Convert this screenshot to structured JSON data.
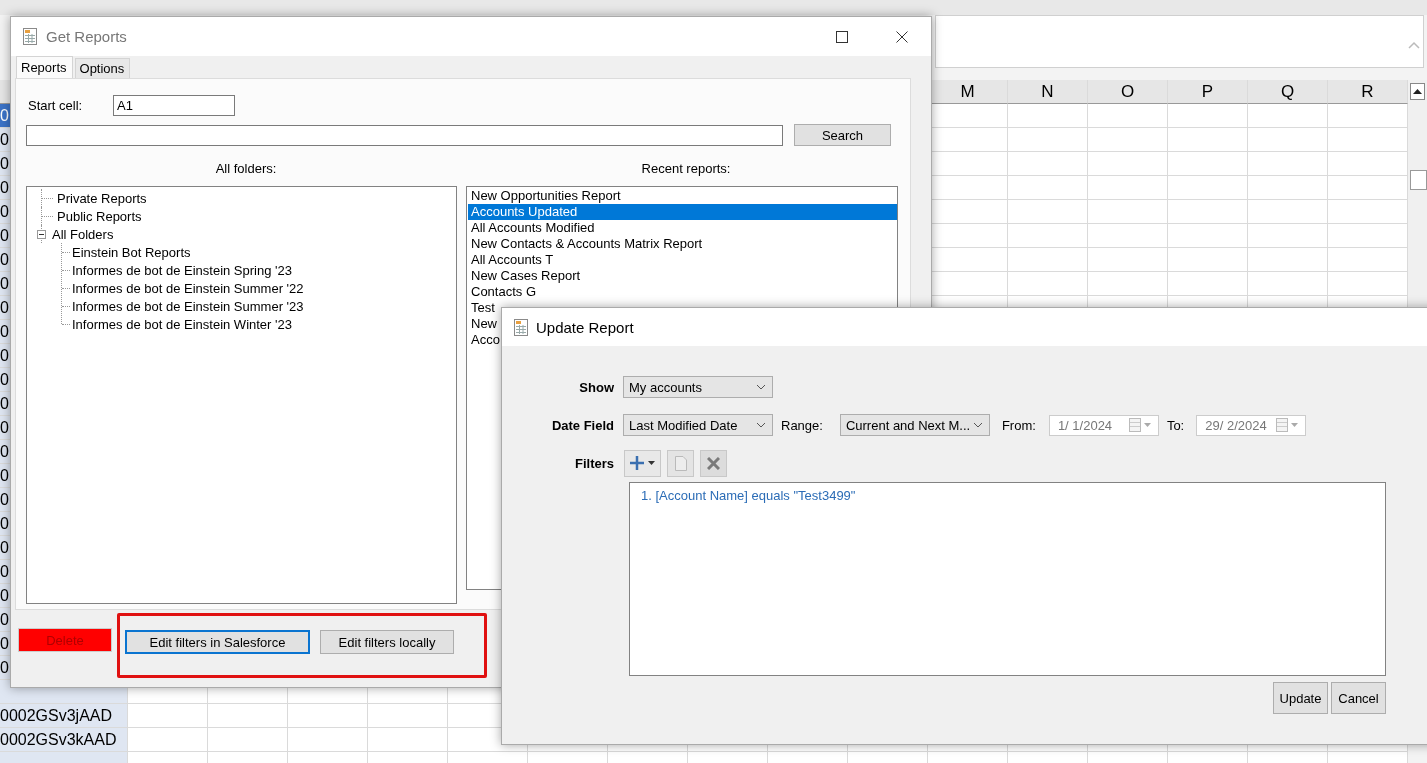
{
  "sheet": {
    "columns": [
      {
        "label": "M"
      },
      {
        "label": "N"
      },
      {
        "label": "O"
      },
      {
        "label": "P"
      },
      {
        "label": "Q"
      },
      {
        "label": "R"
      }
    ],
    "rows": [
      {
        "cell": "0",
        "selected": true
      },
      {
        "cell": "0",
        "selected": false
      },
      {
        "cell": "0",
        "selected": false
      },
      {
        "cell": "0",
        "selected": false
      },
      {
        "cell": "0",
        "selected": false
      },
      {
        "cell": "0",
        "selected": false
      },
      {
        "cell": "0",
        "selected": false
      },
      {
        "cell": "0",
        "selected": false
      },
      {
        "cell": "0",
        "selected": false
      },
      {
        "cell": "0",
        "selected": false
      },
      {
        "cell": "0",
        "selected": false
      },
      {
        "cell": "0",
        "selected": false
      },
      {
        "cell": "0",
        "selected": false
      },
      {
        "cell": "0",
        "selected": false
      },
      {
        "cell": "0",
        "selected": false
      },
      {
        "cell": "0",
        "selected": false
      },
      {
        "cell": "0",
        "selected": false
      },
      {
        "cell": "0",
        "selected": false
      },
      {
        "cell": "0",
        "selected": false
      },
      {
        "cell": "0",
        "selected": false
      },
      {
        "cell": "0",
        "selected": false
      },
      {
        "cell": "0",
        "selected": false
      },
      {
        "cell": "0",
        "selected": false
      },
      {
        "cell": "0",
        "selected": false
      },
      {
        "selected": false
      },
      {
        "cell": "0002GSv3jAAD",
        "selected": false
      },
      {
        "cell": "0002GSv3kAAD",
        "selected": false
      },
      {
        "selected": false
      }
    ]
  },
  "get_reports": {
    "title": "Get Reports",
    "tabs": [
      {
        "label": "Reports",
        "selected": true
      },
      {
        "label": "Options",
        "selected": false
      }
    ],
    "start_cell": {
      "label": "Start cell:",
      "value": "A1"
    },
    "search": {
      "button": "Search"
    },
    "folders": {
      "heading": "All folders:",
      "tree": [
        {
          "label": "Private Reports"
        },
        {
          "label": "Public Reports"
        },
        {
          "label": "All Folders",
          "expanded": true,
          "children": [
            {
              "label": "Einstein Bot Reports"
            },
            {
              "label": "Informes de bot de Einstein Spring '23"
            },
            {
              "label": "Informes de bot de Einstein Summer '22"
            },
            {
              "label": "Informes de bot de Einstein Summer '23"
            },
            {
              "label": "Informes de bot de Einstein Winter '23"
            }
          ]
        }
      ]
    },
    "recent": {
      "heading": "Recent reports:",
      "items": [
        {
          "label": "New Opportunities Report",
          "selected": false
        },
        {
          "label": "Accounts Updated",
          "selected": true
        },
        {
          "label": "All Accounts Modified",
          "selected": false
        },
        {
          "label": "New Contacts & Accounts Matrix Report",
          "selected": false
        },
        {
          "label": "All Accounts T",
          "selected": false
        },
        {
          "label": "New Cases Report",
          "selected": false
        },
        {
          "label": "Contacts G",
          "selected": false
        },
        {
          "label": "Test",
          "selected": false
        },
        {
          "label": "New",
          "selected": false
        },
        {
          "label": "Acco",
          "selected": false
        }
      ]
    },
    "button_groups": [
      {
        "highlighted": false,
        "buttons": [
          {
            "label": "Delete",
            "kind": "danger"
          }
        ]
      },
      {
        "highlighted": true,
        "buttons": [
          {
            "label": "Edit filters in Salesforce",
            "kind": "focused"
          },
          {
            "label": "Edit filters locally",
            "kind": "normal"
          }
        ]
      }
    ]
  },
  "update_report": {
    "title": "Update Report",
    "show": {
      "label": "Show",
      "value": "My accounts"
    },
    "date_field": {
      "label": "Date Field",
      "value": "Last Modified Date"
    },
    "range": {
      "label": "Range:",
      "value": "Current and Next M..."
    },
    "from": {
      "label": "From:",
      "value": "1/  1/2024",
      "disabled": true
    },
    "to": {
      "label": "To:",
      "value": "29/  2/2024",
      "disabled": true
    },
    "filters": {
      "label": "Filters",
      "tools": [
        {
          "kind": "add",
          "disabled": false
        },
        {
          "kind": "copy",
          "disabled": true
        },
        {
          "kind": "delete",
          "disabled": false
        }
      ],
      "items": [
        "1. [Account Name] equals \"Test3499\""
      ]
    },
    "buttons": [
      "Update",
      "Cancel"
    ]
  }
}
